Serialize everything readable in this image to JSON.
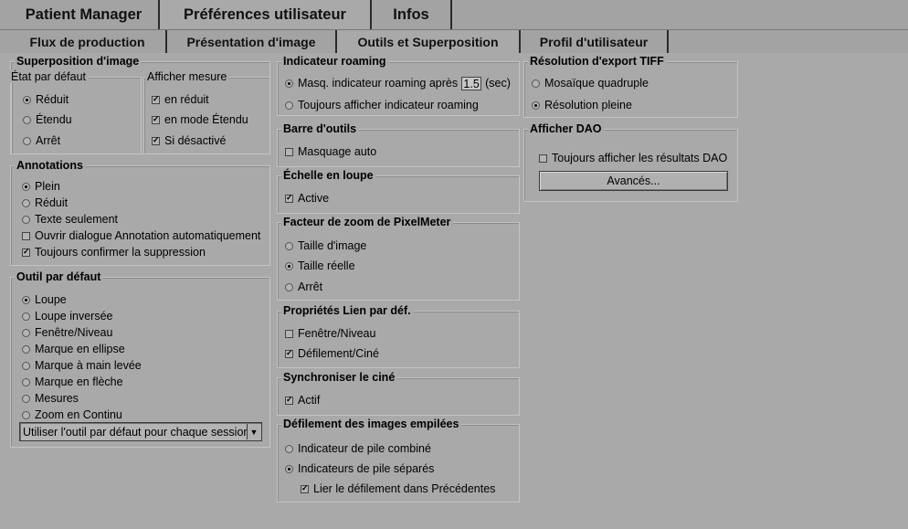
{
  "top_tabs": [
    "Patient Manager",
    "Préférences utilisateur",
    "Infos"
  ],
  "sub_tabs": [
    "Flux de production",
    "Présentation d'image",
    "Outils et Superposition",
    "Profil d'utilisateur"
  ],
  "superposition": {
    "title": "Superposition d'image",
    "etat_title": "État par défaut",
    "etat_options": [
      "Réduit",
      "Étendu",
      "Arrêt"
    ],
    "etat_selected": 0,
    "mesure_title": "Afficher mesure",
    "mesure_options": [
      "en réduit",
      "en mode Étendu",
      "Si désactivé"
    ],
    "mesure_checked": [
      true,
      true,
      true
    ]
  },
  "annotations": {
    "title": "Annotations",
    "options": [
      "Plein",
      "Réduit",
      "Texte seulement"
    ],
    "selected": 0,
    "checks": [
      "Ouvrir dialogue Annotation automatiquement",
      "Toujours confirmer la suppression"
    ],
    "checked": [
      false,
      true
    ]
  },
  "outil": {
    "title": "Outil par défaut",
    "options": [
      "Loupe",
      "Loupe inversée",
      "Fenêtre/Niveau",
      "Marque en ellipse",
      "Marque à main levée",
      "Marque en flèche",
      "Mesures",
      "Zoom en Continu"
    ],
    "selected": 0,
    "dropdown_value": "Utiliser l'outil par défaut pour chaque session",
    "dropdown_arrow": "▼"
  },
  "roaming": {
    "title": "Indicateur roaming",
    "opt1_prefix": "Masq. indicateur roaming après",
    "opt1_value": "1.5",
    "opt1_suffix": "(sec)",
    "opt2": "Toujours afficher indicateur roaming",
    "selected": 0
  },
  "barre": {
    "title": "Barre d'outils",
    "check": "Masquage auto",
    "checked": false
  },
  "echelle": {
    "title": "Échelle en loupe",
    "check": "Active",
    "checked": true
  },
  "pixelmeter": {
    "title": "Facteur de zoom de PixelMeter",
    "options": [
      "Taille d'image",
      "Taille réelle",
      "Arrêt"
    ],
    "selected": 1
  },
  "lien": {
    "title": "Propriétés Lien par déf.",
    "checks": [
      "Fenêtre/Niveau",
      "Défilement/Ciné"
    ],
    "checked": [
      false,
      true
    ]
  },
  "cine": {
    "title": "Synchroniser le ciné",
    "check": "Actif",
    "checked": true
  },
  "defilement": {
    "title": "Défilement des images empilées",
    "options": [
      "Indicateur de pile combiné",
      "Indicateurs de pile séparés"
    ],
    "selected": 1,
    "check": "Lier le défilement dans Précédentes",
    "checked": true
  },
  "tiff": {
    "title": "Résolution d'export TIFF",
    "options": [
      "Mosaïque quadruple",
      "Résolution pleine"
    ],
    "selected": 1
  },
  "dao": {
    "title": "Afficher DAO",
    "check": "Toujours afficher les résultats DAO",
    "checked": false,
    "button": "Avancés..."
  }
}
